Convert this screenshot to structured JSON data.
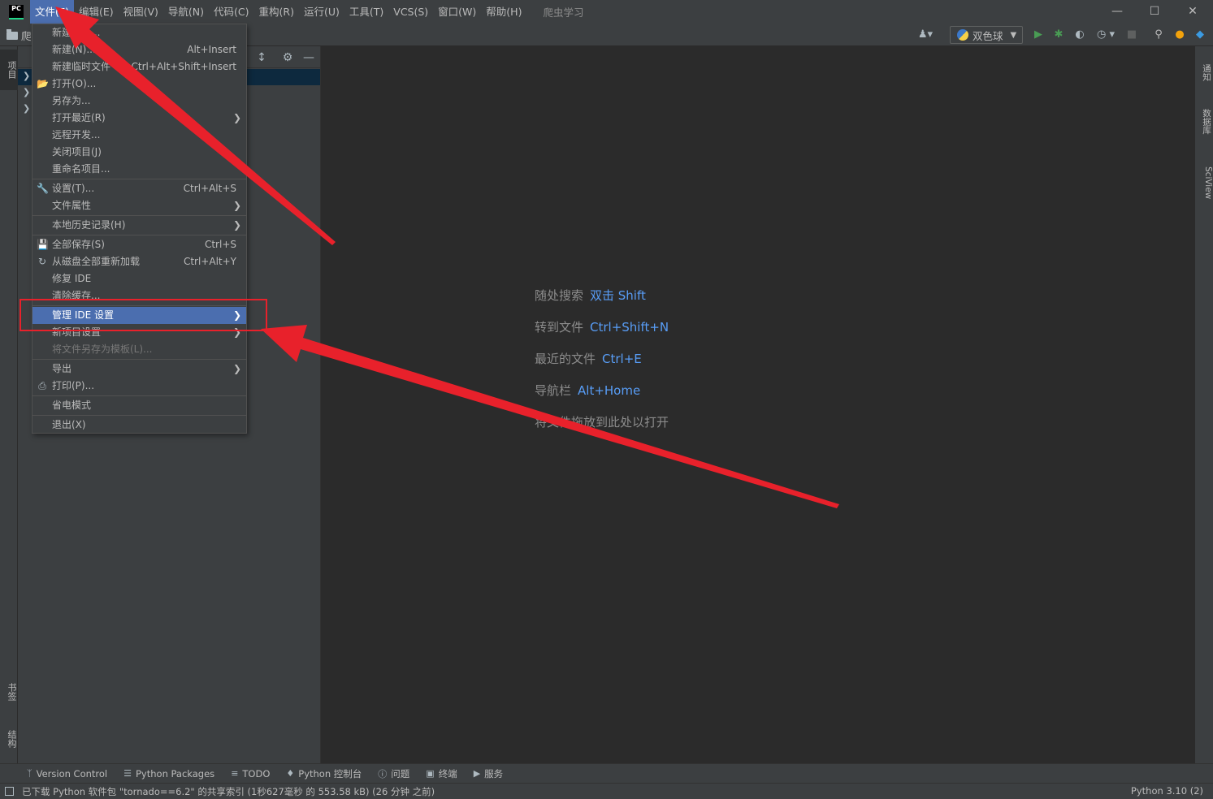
{
  "menubar": {
    "items": [
      "文件(F)",
      "编辑(E)",
      "视图(V)",
      "导航(N)",
      "代码(C)",
      "重构(R)",
      "运行(U)",
      "工具(T)",
      "VCS(S)",
      "窗口(W)",
      "帮助(H)"
    ],
    "project_title": "爬虫学习",
    "logo": "PC"
  },
  "toolbar": {
    "breadcrumb": "爬",
    "run_config": "双色球"
  },
  "left_strip": {
    "project_tab": "项目",
    "bookmarks_tab": "书签",
    "structure_tab": "结构"
  },
  "right_strip": {
    "notifications_tab": "通知",
    "database_tab": "数据库",
    "sciview_tab": "SciView"
  },
  "file_menu": {
    "new_project": "新建项目...",
    "new": "新建(N)...",
    "new_shortcut": "Alt+Insert",
    "new_scratch": "新建临时文件",
    "new_scratch_shortcut": "Ctrl+Alt+Shift+Insert",
    "open": "打开(O)...",
    "save_as": "另存为...",
    "open_recent": "打开最近(R)",
    "remote_dev": "远程开发...",
    "close_project": "关闭项目(J)",
    "rename_project": "重命名项目...",
    "settings": "设置(T)...",
    "settings_shortcut": "Ctrl+Alt+S",
    "file_properties": "文件属性",
    "local_history": "本地历史记录(H)",
    "save_all": "全部保存(S)",
    "save_all_shortcut": "Ctrl+S",
    "reload_all": "从磁盘全部重新加载",
    "reload_all_shortcut": "Ctrl+Alt+Y",
    "repair_ide": "修复 IDE",
    "invalidate_caches": "清除缓存...",
    "manage_ide_settings": "管理 IDE 设置",
    "new_project_settings": "新项目设置",
    "save_as_template": "将文件另存为模板(L)...",
    "export": "导出",
    "print": "打印(P)...",
    "power_save": "省电模式",
    "exit": "退出(X)"
  },
  "editor_hints": [
    {
      "label": "随处搜索",
      "key": "双击 Shift"
    },
    {
      "label": "转到文件",
      "key": "Ctrl+Shift+N"
    },
    {
      "label": "最近的文件",
      "key": "Ctrl+E"
    },
    {
      "label": "导航栏",
      "key": "Alt+Home"
    },
    {
      "label": "将文件拖放到此处以打开",
      "key": ""
    }
  ],
  "bottom_tabs": [
    "Version Control",
    "Python Packages",
    "TODO",
    "Python 控制台",
    "问题",
    "终端",
    "服务"
  ],
  "status": {
    "message": "已下载 Python 软件包 \"tornado==6.2\" 的共享索引 (1秒627毫秒 的 553.58 kB) (26 分钟 之前)",
    "interpreter": "Python 3.10 (2)"
  },
  "colors": {
    "accent": "#4b6eaf",
    "annotation": "#e8212b",
    "hint_key": "#589df6"
  }
}
